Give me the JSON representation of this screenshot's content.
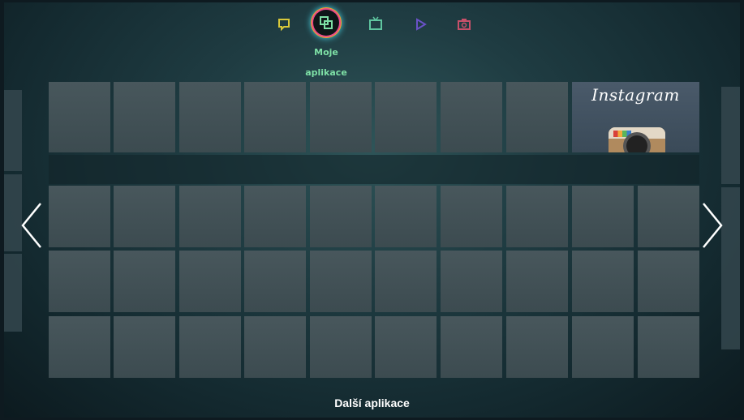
{
  "top_nav": {
    "items": [
      {
        "icon": "chat-icon",
        "color": "#d8c83a"
      },
      {
        "icon": "apps-icon",
        "color": "#7ee0a6",
        "active": true
      },
      {
        "icon": "tv-icon",
        "color": "#5fc6a0"
      },
      {
        "icon": "play-icon",
        "color": "#6a52c8"
      },
      {
        "icon": "camera-icon",
        "color": "#c8506a"
      }
    ],
    "active_label_line1": "Moje",
    "active_label_line2": "aplikace"
  },
  "featured_app": {
    "name": "Instagram"
  },
  "bottom_label": "Další aplikace",
  "colors": {
    "accent_label": "#7ee0a6",
    "tile": "#44545a",
    "background": "#1f3c42"
  }
}
